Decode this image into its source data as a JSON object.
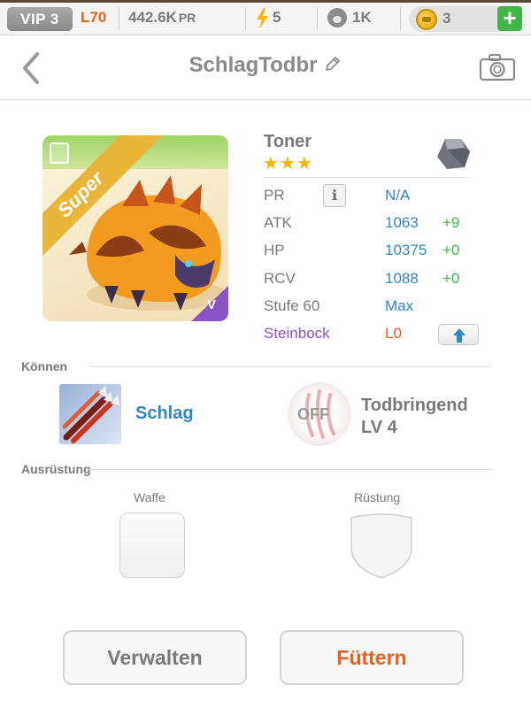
{
  "status_bar": {
    "vip": "VIP 3",
    "level": "L70",
    "power": "442.6K",
    "power_unit": "PR",
    "energy": "5",
    "food": "1K",
    "coins": "3",
    "add_label": "+",
    "icons": [
      "bolt-icon",
      "paw-icon",
      "coin-icon",
      "plus-icon"
    ]
  },
  "header": {
    "title": "SchlagTodbr",
    "icons": [
      "back-arrow-icon",
      "pencil-icon",
      "camera-icon"
    ]
  },
  "monster": {
    "tag": "Super",
    "badge": "V",
    "name": "Toner",
    "stars": "★★★",
    "stats": [
      {
        "label": "PR",
        "value": "N/A",
        "bonus": ""
      },
      {
        "label": "ATK",
        "value": "1063",
        "bonus": "+9"
      },
      {
        "label": "HP",
        "value": "10375",
        "bonus": "+0"
      },
      {
        "label": "RCV",
        "value": "1088",
        "bonus": "+0"
      },
      {
        "label": "Stufe 60",
        "value": "Max",
        "bonus": ""
      },
      {
        "label": "Steinbock",
        "value": "L0",
        "bonus": ""
      }
    ],
    "colors": {
      "value": "#2f86c9",
      "bonus": "#43b649",
      "zodiac": "#8a53c6",
      "zodiac_level": "#e8601d"
    }
  },
  "skills": {
    "section_label": "Können",
    "skill1": "Schlag",
    "skill2_state": "OFF",
    "skill2_name": "Todbringend",
    "skill2_level": "LV 4"
  },
  "equipment": {
    "section_label": "Ausrüstung",
    "weapon_label": "Waffe",
    "armor_label": "Rüstung"
  },
  "buttons": {
    "manage": "Verwalten",
    "feed": "Füttern"
  },
  "accent_colors": {
    "orange": "#e8601d",
    "blue": "#2f86c9",
    "green": "#43b649"
  }
}
